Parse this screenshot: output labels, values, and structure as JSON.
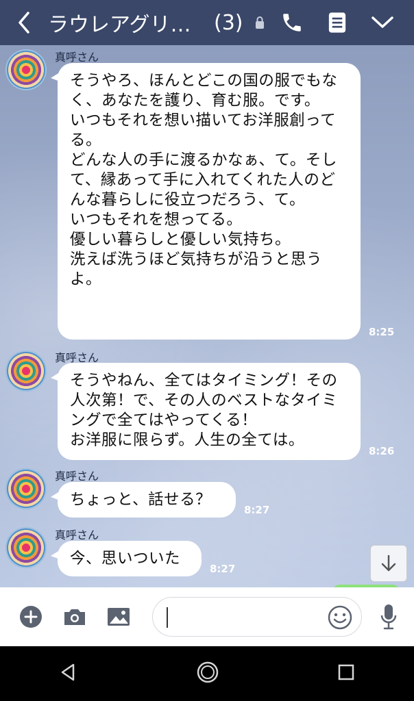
{
  "header": {
    "title": "ラウレアグリー…",
    "member_count": "(3)",
    "icons": [
      "back-icon",
      "lock-icon",
      "phone-icon",
      "notes-icon",
      "chevron-down-icon"
    ]
  },
  "messages": [
    {
      "sender": "真呼さん",
      "text": "そうやろ、ほんとどこの国の服でもなく、あなたを護り、育む服。です。\nいつもそれを想い描いてお洋服創ってる。\nどんな人の手に渡るかなぁ、て。そして、縁あって手に入れてくれた人のどんな暮らしに役立つだろう、て。\nいつもそれを想ってる。\n優しい暮らしと優しい気持ち。\n洗えば洗うほど気持ちが沿うと思うよ。",
      "time": "8:25"
    },
    {
      "sender": "真呼さん",
      "text": "そうやねん、全てはタイミング！その人次第！で、その人のベストなタイミングで全てはやってくる！\nお洋服に限らず。人生の全ては。",
      "time": "8:26"
    },
    {
      "sender": "真呼さん",
      "text": "ちょっと、話せる？",
      "time": "8:27"
    },
    {
      "sender": "真呼さん",
      "text": "今、思いついた",
      "time": "8:27"
    }
  ],
  "input_bar": {
    "message_value": "",
    "icons": [
      "add-icon",
      "camera-icon",
      "image-icon",
      "emoji-icon",
      "microphone-icon"
    ]
  },
  "navbar": {
    "icons": [
      "nav-back-icon",
      "nav-home-icon",
      "nav-recents-icon"
    ]
  },
  "colors": {
    "header_bg": "#3a4768",
    "bubble_bg": "#ffffff",
    "chat_bg": "#93a4c4",
    "sent_bubble": "#8de07a"
  }
}
